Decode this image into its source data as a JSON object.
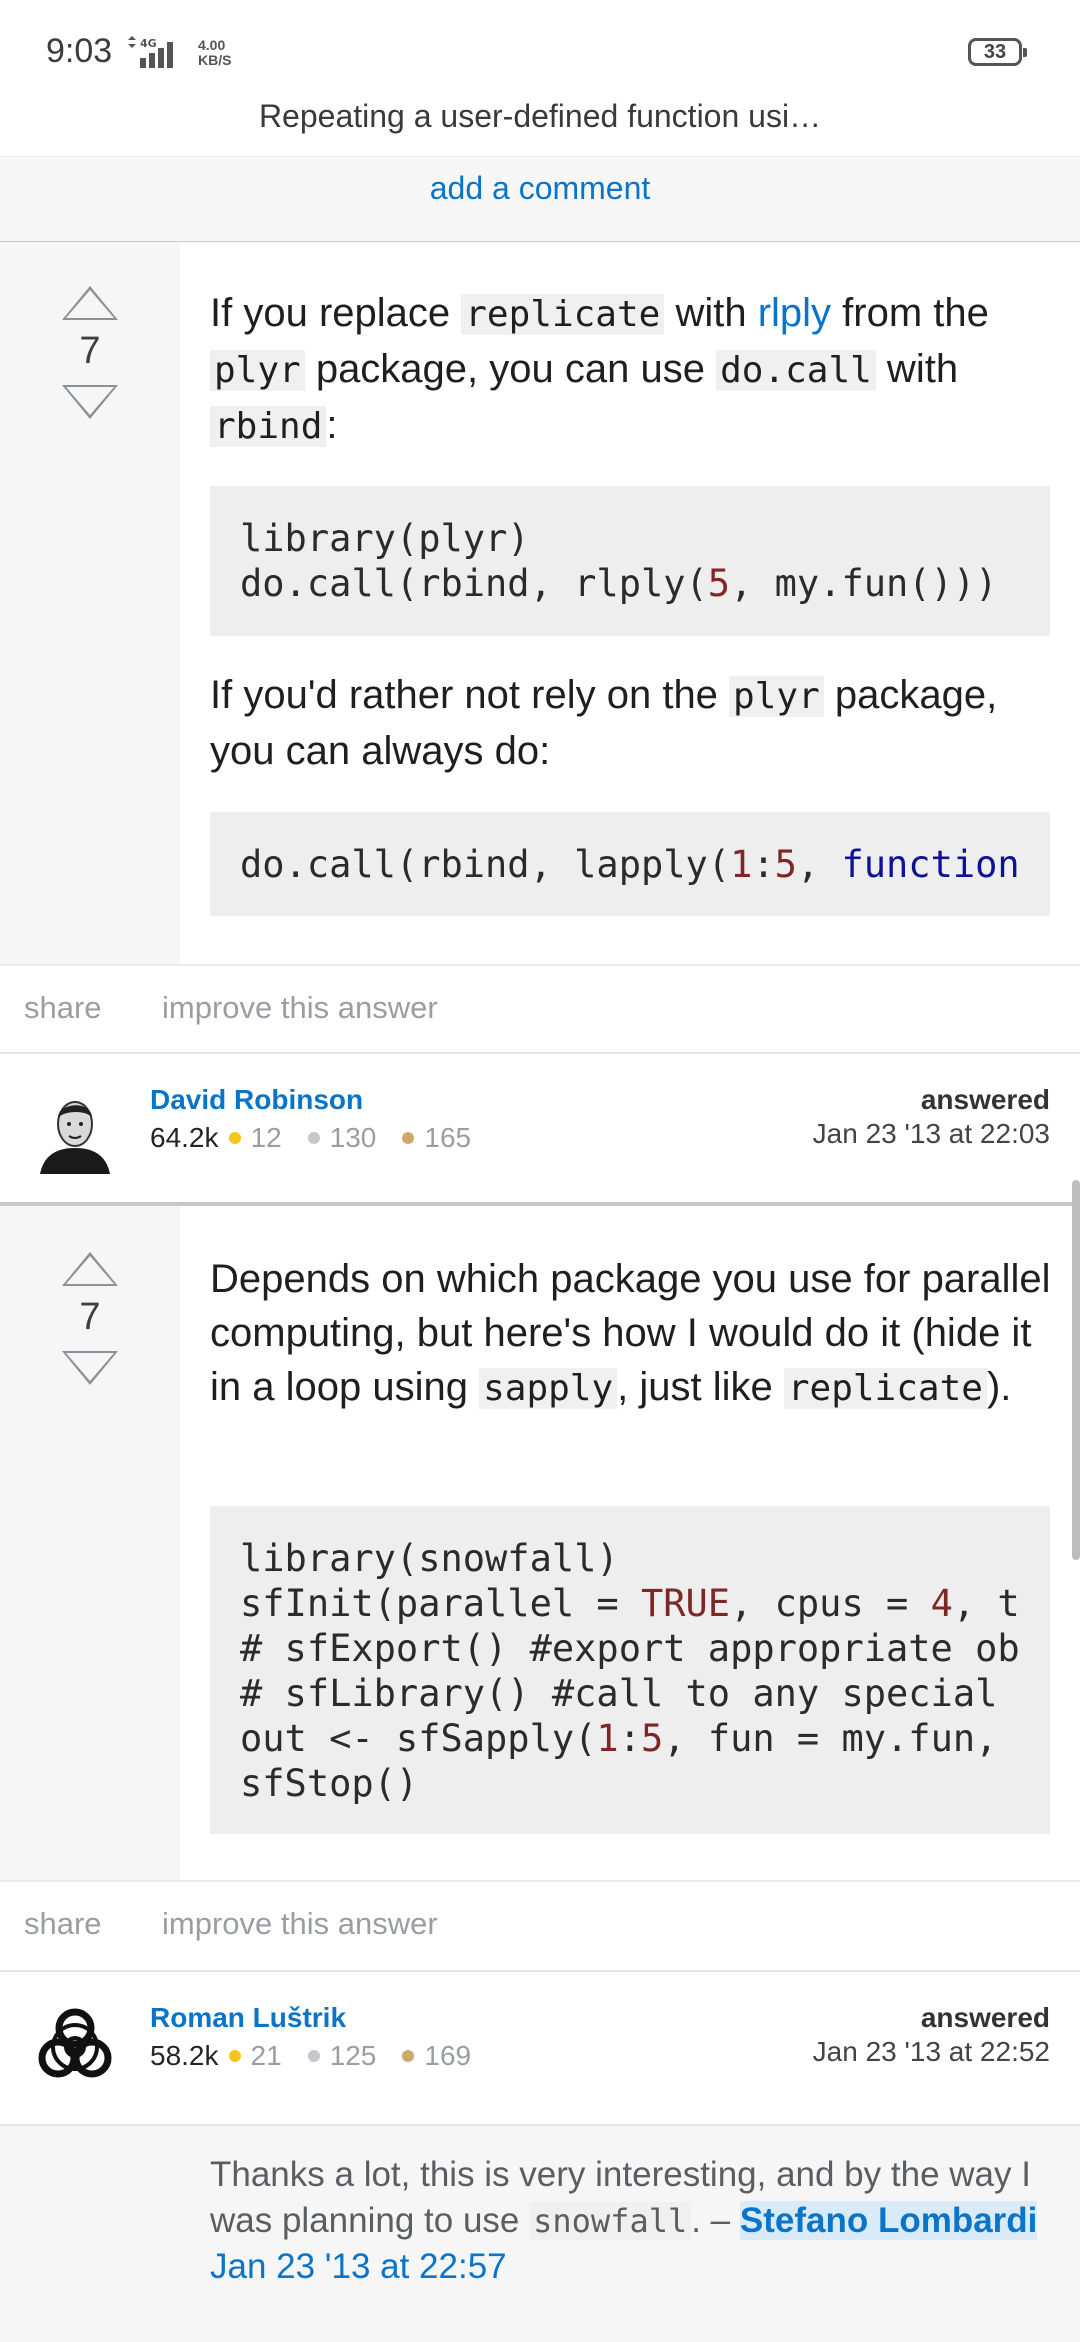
{
  "status": {
    "time": "9:03",
    "network": "4G",
    "speed_value": "4.00",
    "speed_unit": "KB/S",
    "battery": "33"
  },
  "page": {
    "title": "Repeating a user-defined function usi…",
    "add_comment": "add a comment"
  },
  "answers": [
    {
      "votes": "7",
      "intro": {
        "t1": "If you replace ",
        "c1": "replicate",
        "t2": " with ",
        "link": "rlply",
        "t3": " from the ",
        "c2": "plyr",
        "t4": " package, you can use ",
        "c3": "do.call",
        "t5": " with ",
        "c4": "rbind",
        "t6": ":"
      },
      "code1": {
        "l1": "library(plyr)",
        "l2a": "do.call(rbind, rlply(",
        "l2n": "5",
        "l2b": ", my.fun()))"
      },
      "mid": {
        "t1": "If you'd rather not rely on the ",
        "c1": "plyr",
        "t2": " package, you can always do:"
      },
      "code2": {
        "a": "do.call(rbind, lapply(",
        "n1": "1",
        "b": ":",
        "n2": "5",
        "c": ", ",
        "kw": "function"
      },
      "share": "share",
      "improve": "improve this answer",
      "user": {
        "name": "David Robinson",
        "rep": "64.2k",
        "gold": "12",
        "silver": "130",
        "bronze": "165"
      },
      "answered_label": "answered",
      "answered_date": "Jan 23 '13 at 22:03"
    },
    {
      "votes": "7",
      "intro": {
        "t1": "Depends on which package you use for parallel computing, but here's how I would do it (hide it in a loop using ",
        "c1": "sapply",
        "t2": ", just like ",
        "c2": "replicate",
        "t3": ")."
      },
      "code": {
        "l1": "library(snowfall)",
        "l2a": "sfInit(parallel = ",
        "l2t": "TRUE",
        "l2b": ", cpus = ",
        "l2n": "4",
        "l2c": ", t",
        "l3": "# sfExport() #export appropriate ob",
        "l4": "# sfLibrary() #call to any special",
        "l5a": "out <- sfSapply(",
        "l5n1": "1",
        "l5b": ":",
        "l5n2": "5",
        "l5c": ", fun = my.fun,",
        "l6": "sfStop()"
      },
      "share": "share",
      "improve": "improve this answer",
      "user": {
        "name": "Roman Luštrik",
        "rep": "58.2k",
        "gold": "21",
        "silver": "125",
        "bronze": "169"
      },
      "answered_label": "answered",
      "answered_date": "Jan 23 '13 at 22:52"
    }
  ],
  "comment": {
    "text1": "Thanks a lot, this is very interesting, and by the way I was planning to use ",
    "code": "snowfall",
    "text2": ". – ",
    "author": "Stefano Lombardi",
    "date": "Jan 23 '13 at 22:57"
  },
  "colors": {
    "link": "#0a74c9",
    "gold": "#f5c518",
    "silver": "#c4c8cc",
    "bronze": "#d1a66a"
  }
}
